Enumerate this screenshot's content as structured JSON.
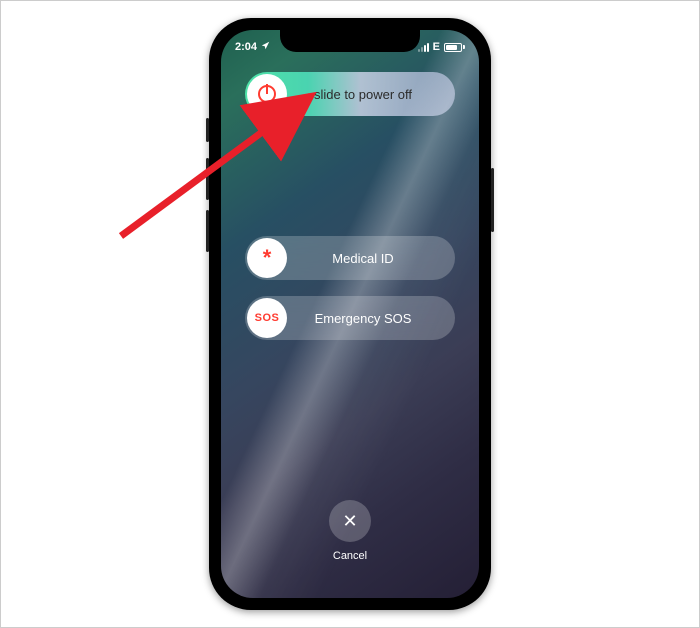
{
  "status_bar": {
    "time": "2:04",
    "location_on": true,
    "carrier": "E"
  },
  "sliders": {
    "power_off": {
      "label": "slide to power off",
      "icon": "power-icon"
    },
    "medical": {
      "label": "Medical ID",
      "icon": "asterisk-icon",
      "glyph": "*"
    },
    "sos": {
      "label": "Emergency SOS",
      "icon": "sos-icon",
      "glyph": "SOS"
    }
  },
  "cancel": {
    "label": "Cancel"
  },
  "colors": {
    "accent_red": "#ff3b30",
    "knob_bg": "#ffffff"
  }
}
